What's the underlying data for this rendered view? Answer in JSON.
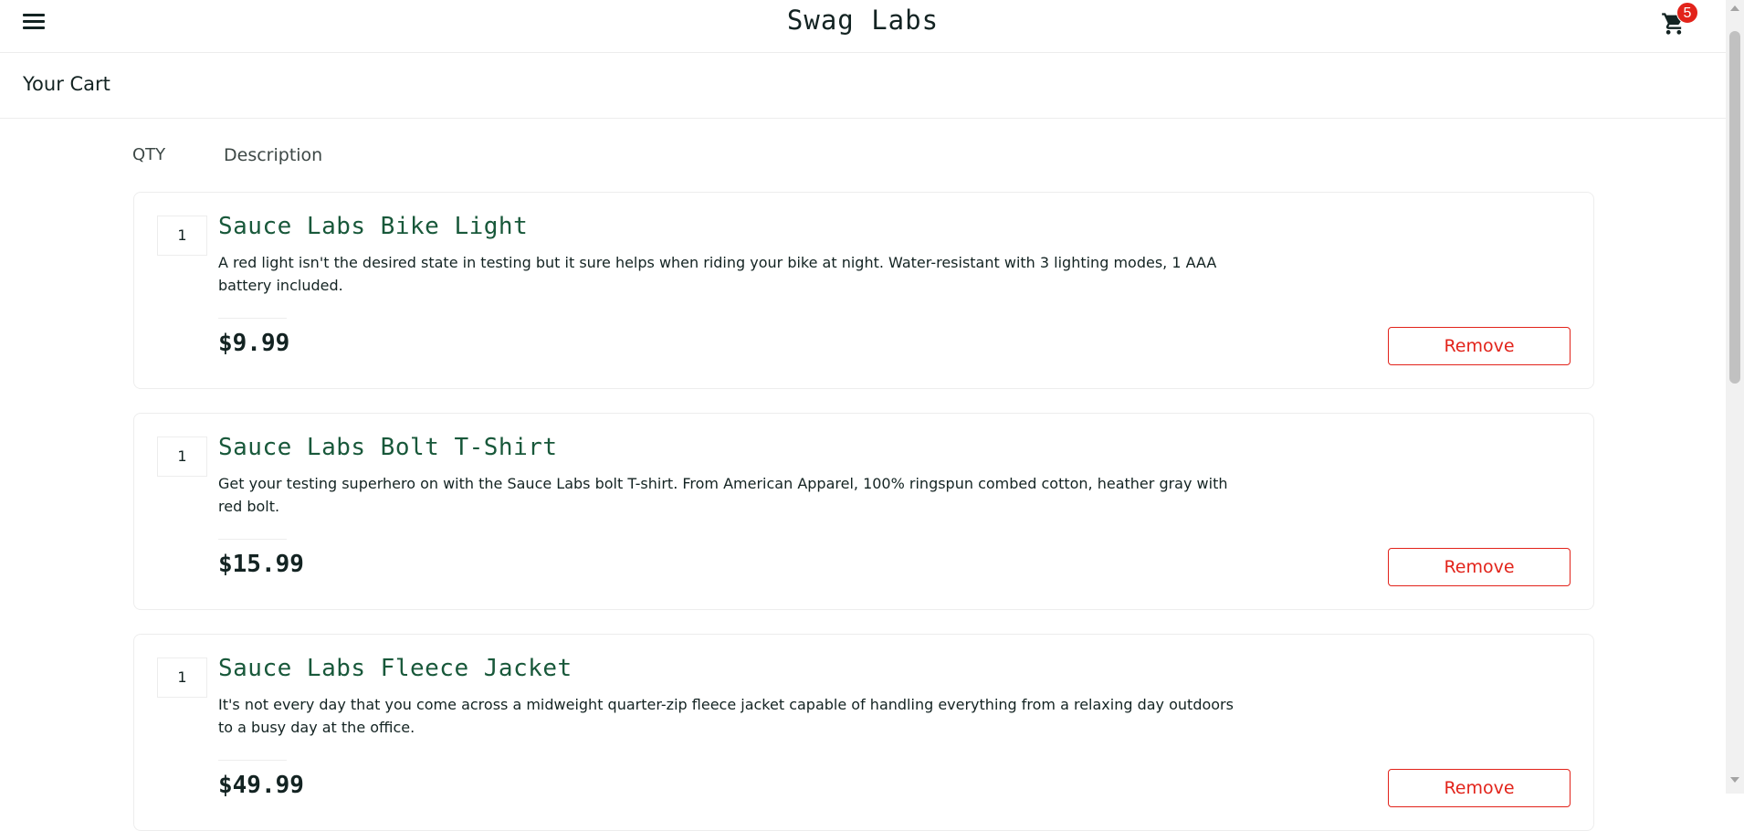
{
  "header": {
    "menu_icon": "hamburger-menu-icon",
    "logo": "Swag Labs",
    "cart_icon": "shopping-cart-icon",
    "cart_count": "5"
  },
  "secondary_header": {
    "title": "Your Cart"
  },
  "cart_list": {
    "qty_label": "QTY",
    "desc_label": "Description",
    "items": [
      {
        "quantity": "1",
        "name": "Sauce Labs Bike Light",
        "description": "A red light isn't the desired state in testing but it sure helps when riding your bike at night. Water-resistant with 3 lighting modes, 1 AAA battery included.",
        "price": "$9.99",
        "remove_label": "Remove"
      },
      {
        "quantity": "1",
        "name": "Sauce Labs Bolt T-Shirt",
        "description": "Get your testing superhero on with the Sauce Labs bolt T-shirt. From American Apparel, 100% ringspun combed cotton, heather gray with red bolt.",
        "price": "$15.99",
        "remove_label": "Remove"
      },
      {
        "quantity": "1",
        "name": "Sauce Labs Fleece Jacket",
        "description": "It's not every day that you come across a midweight quarter-zip fleece jacket capable of handling everything from a relaxing day outdoors to a busy day at the office.",
        "price": "$49.99",
        "remove_label": "Remove"
      }
    ]
  },
  "colors": {
    "item_name": "#18583a",
    "remove": "#e2231a",
    "badge": "#e2231a",
    "text": "#132322"
  }
}
